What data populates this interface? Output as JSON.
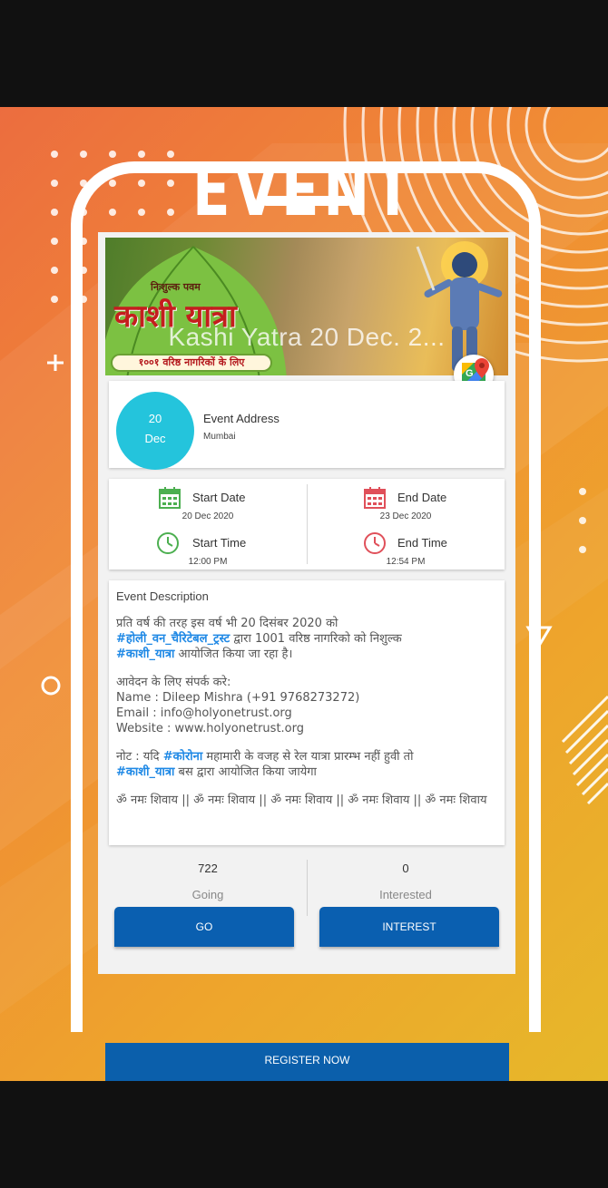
{
  "header": {
    "title": "EVENT"
  },
  "banner": {
    "overlay_title": "Kashi Yatra 20 Dec. 2...",
    "hindi_title": "काशी यात्रा",
    "hindi_small": "निःशुल्क पवम",
    "hindi_ribbon": "१००१ वरिष्ठ नागरिकों के लिए"
  },
  "event": {
    "date_day": "20",
    "date_month": "Dec",
    "address_label": "Event Address",
    "address_value": "Mumbai"
  },
  "schedule": {
    "start_date_label": "Start Date",
    "start_date_value": "20 Dec 2020",
    "end_date_label": "End Date",
    "end_date_value": "23 Dec 2020",
    "start_time_label": "Start Time",
    "start_time_value": "12:00 PM",
    "end_time_label": "End Time",
    "end_time_value": "12:54 PM"
  },
  "description": {
    "title": "Event Description",
    "p1_a": "प्रति वर्ष की तरह इस वर्ष भी 20 दिसंबर 2020 को",
    "p1_tag1": "#होली_वन_चैरिटेबल_ट्रस्ट",
    "p1_b": " द्वारा 1001 वरिष्ठ नागरिको को निशुल्क",
    "p1_tag2": "#काशी_यात्रा",
    "p1_c": " आयोजित किया जा रहा है।",
    "contact_heading": "आवेदन के लिए संपर्क करे:",
    "contact_name": "Name : Dileep Mishra (+91 9768273272)",
    "contact_email": "Email  : info@holyonetrust.org",
    "contact_website": "Website : www.holyonetrust.org",
    "note_a": "नोट : यदि ",
    "note_tag1": "#कोरोना",
    "note_b": " महामारी के वजह से रेल यात्रा प्रारम्भ नहीं हुवी तो",
    "note_tag2": "#काशी_यात्रा",
    "note_c": " बस द्वारा आयोजित किया जायेगा",
    "mantra": "ॐ नमः शिवाय || ॐ नमः शिवाय || ॐ नमः शिवाय || ॐ नमः शिवाय || ॐ नमः शिवाय"
  },
  "stats": {
    "going_count": "722",
    "going_label": "Going",
    "interested_count": "0",
    "interested_label": "Interested",
    "go_button": "GO",
    "interest_button": "INTEREST"
  },
  "register_button": "REGISTER NOW",
  "colors": {
    "accent_blue": "#0a5fb0",
    "date_circle": "#24c4dc",
    "hashtag": "#1e88e5",
    "calendar_green": "#4caf50",
    "calendar_red": "#e0505a"
  }
}
